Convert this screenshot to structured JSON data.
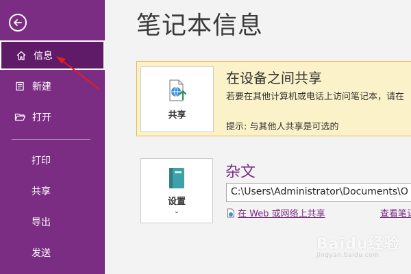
{
  "sidebar": {
    "items": [
      {
        "label": "信息",
        "icon": "home-icon",
        "active": true
      },
      {
        "label": "新建",
        "icon": "new-page-icon"
      },
      {
        "label": "打开",
        "icon": "folder-open-icon"
      },
      {
        "label": "打印"
      },
      {
        "label": "共享"
      },
      {
        "label": "导出"
      },
      {
        "label": "发送"
      }
    ],
    "back_icon": "back-arrow-icon"
  },
  "main": {
    "title": "笔记本信息",
    "share_panel": {
      "tile_label": "共享",
      "heading": "在设备之间共享",
      "description": "若要在其他计算机或电话上访问笔记本，请在",
      "hint": "提示: 与其他人共享是可选的"
    },
    "notebook": {
      "settings_label": "设置",
      "name": "杂文",
      "path": "C:\\Users\\Administrator\\Documents\\O",
      "web_share_link": "在 Web 或网络上共享",
      "view_link": "查看笔记"
    }
  },
  "watermark": {
    "main": "Baidu经验",
    "sub": "jingyan.baidu.com"
  },
  "colors": {
    "sidebar": "#7b2d83",
    "sidebar_active": "#5f1b67",
    "share_panel_bg": "#fcf2c9",
    "share_panel_border": "#e6b54a",
    "accent_text": "#7b2d83",
    "annotation_arrow": "#e02020"
  }
}
